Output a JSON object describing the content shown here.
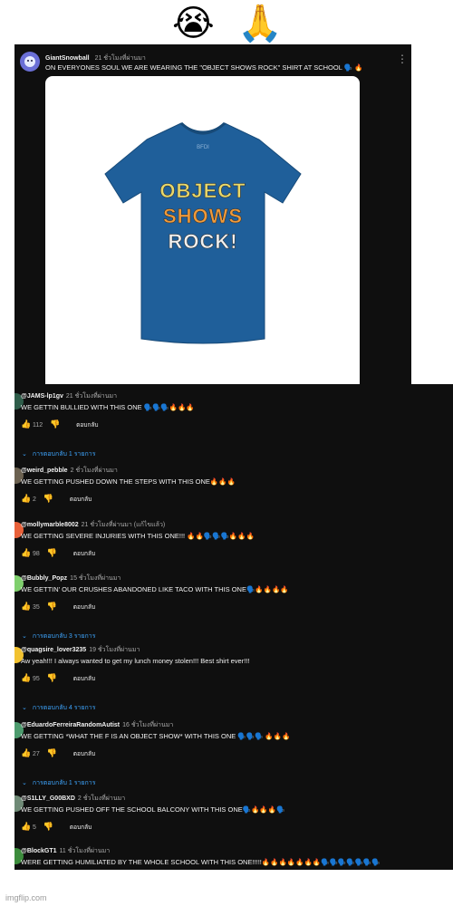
{
  "emojis": {
    "left": "😭",
    "right": "🙏"
  },
  "post": {
    "author": "GiantSnowball",
    "time": "21 ชั่วโมงที่ผ่านมา",
    "text": "ON EVERYONES SOUL WE ARE WEARING THE \"OBJECT SHOWS ROCK\" SHIRT AT SCHOOL 🗣️ 🔥",
    "more_icon": "⋮",
    "shirt": {
      "logo": "BFDI",
      "line1": "OBJECT",
      "line2": "SHOWS",
      "line3": "ROCK!",
      "color": "#1f5f9a"
    }
  },
  "comments": [
    {
      "user": "@JAMS-lp1gv",
      "time": "21 ชั่วโมงที่ผ่านมา",
      "text": "WE GETTIN BULLIED WITH THIS ONE 🗣️🗣️🗣️🔥🔥🔥",
      "likes": "112",
      "reply": "ตอบกลับ",
      "replies": "การตอบกลับ 1 รายการ",
      "avatar_color": "#2f5d4a"
    },
    {
      "user": "@weird_pebble",
      "time": "2 ชั่วโมงที่ผ่านมา",
      "text": "WE GETTING PUSHED DOWN THE STEPS WITH THIS ONE🔥🔥🔥",
      "likes": "2",
      "reply": "ตอบกลับ",
      "replies": "",
      "avatar_color": "#6b6150"
    },
    {
      "user": "@mollymarble8002",
      "time": "21 ชั่วโมงที่ผ่านมา (แก้ไขแล้ว)",
      "text": "WE GETTING SEVERE INJURIES WITH THIS ONE!!! 🔥🔥🗣️🗣️🗣️🔥🔥🔥",
      "likes": "98",
      "reply": "ตอบกลับ",
      "replies": "",
      "avatar_color": "#e8613a"
    },
    {
      "user": "@Bubbly_Popz",
      "time": "15 ชั่วโมงที่ผ่านมา",
      "text": "WE GETTIN' OUR CRUSHES ABANDONED LIKE TACO WITH THIS ONE🗣️🔥🔥🔥🔥",
      "likes": "35",
      "reply": "ตอบกลับ",
      "replies": "การตอบกลับ 3 รายการ",
      "avatar_color": "#7fcf6d"
    },
    {
      "user": "@quagsire_lover3235",
      "time": "19 ชั่วโมงที่ผ่านมา",
      "text": "Aw yeah!!! I always wanted to get my lunch money stolen!!! Best shirt ever!!!",
      "likes": "95",
      "reply": "ตอบกลับ",
      "replies": "การตอบกลับ 4 รายการ",
      "avatar_color": "#f2c230"
    },
    {
      "user": "@EduardoFerreiraRandomAutist",
      "time": "16 ชั่วโมงที่ผ่านมา",
      "text": "WE GETTING *WHAT THE F IS AN OBJECT SHOW* WITH THIS ONE 🗣️🗣️🗣️ 🔥🔥🔥",
      "likes": "27",
      "reply": "ตอบกลับ",
      "replies": "การตอบกลับ 1 รายการ",
      "avatar_color": "#4d9b6e"
    },
    {
      "user": "@S1LLY_G00BXD",
      "time": "2 ชั่วโมงที่ผ่านมา",
      "text": "WE GETTING PUSHED OFF THE SCHOOL BALCONY WITH THIS ONE🗣️🔥🔥🔥🗣️",
      "likes": "5",
      "reply": "ตอบกลับ",
      "replies": "",
      "avatar_color": "#6f8a76"
    },
    {
      "user": "@BlockGT1",
      "time": "11 ชั่วโมงที่ผ่านมา",
      "text": "WERE GETTING HUMILIATED BY THE WHOLE SCHOOL WITH THIS ONE!!!!!🔥🔥🔥🔥🔥🔥🔥🗣️🗣️🗣️🗣️🗣️🗣️🗣️",
      "likes": "",
      "reply": "",
      "replies": "",
      "avatar_color": "#3c8c3c"
    }
  ],
  "icons": {
    "like": "like-icon",
    "dislike": "dislike-icon",
    "chevron": "chevron-down-icon"
  },
  "watermark": "imgflip.com"
}
